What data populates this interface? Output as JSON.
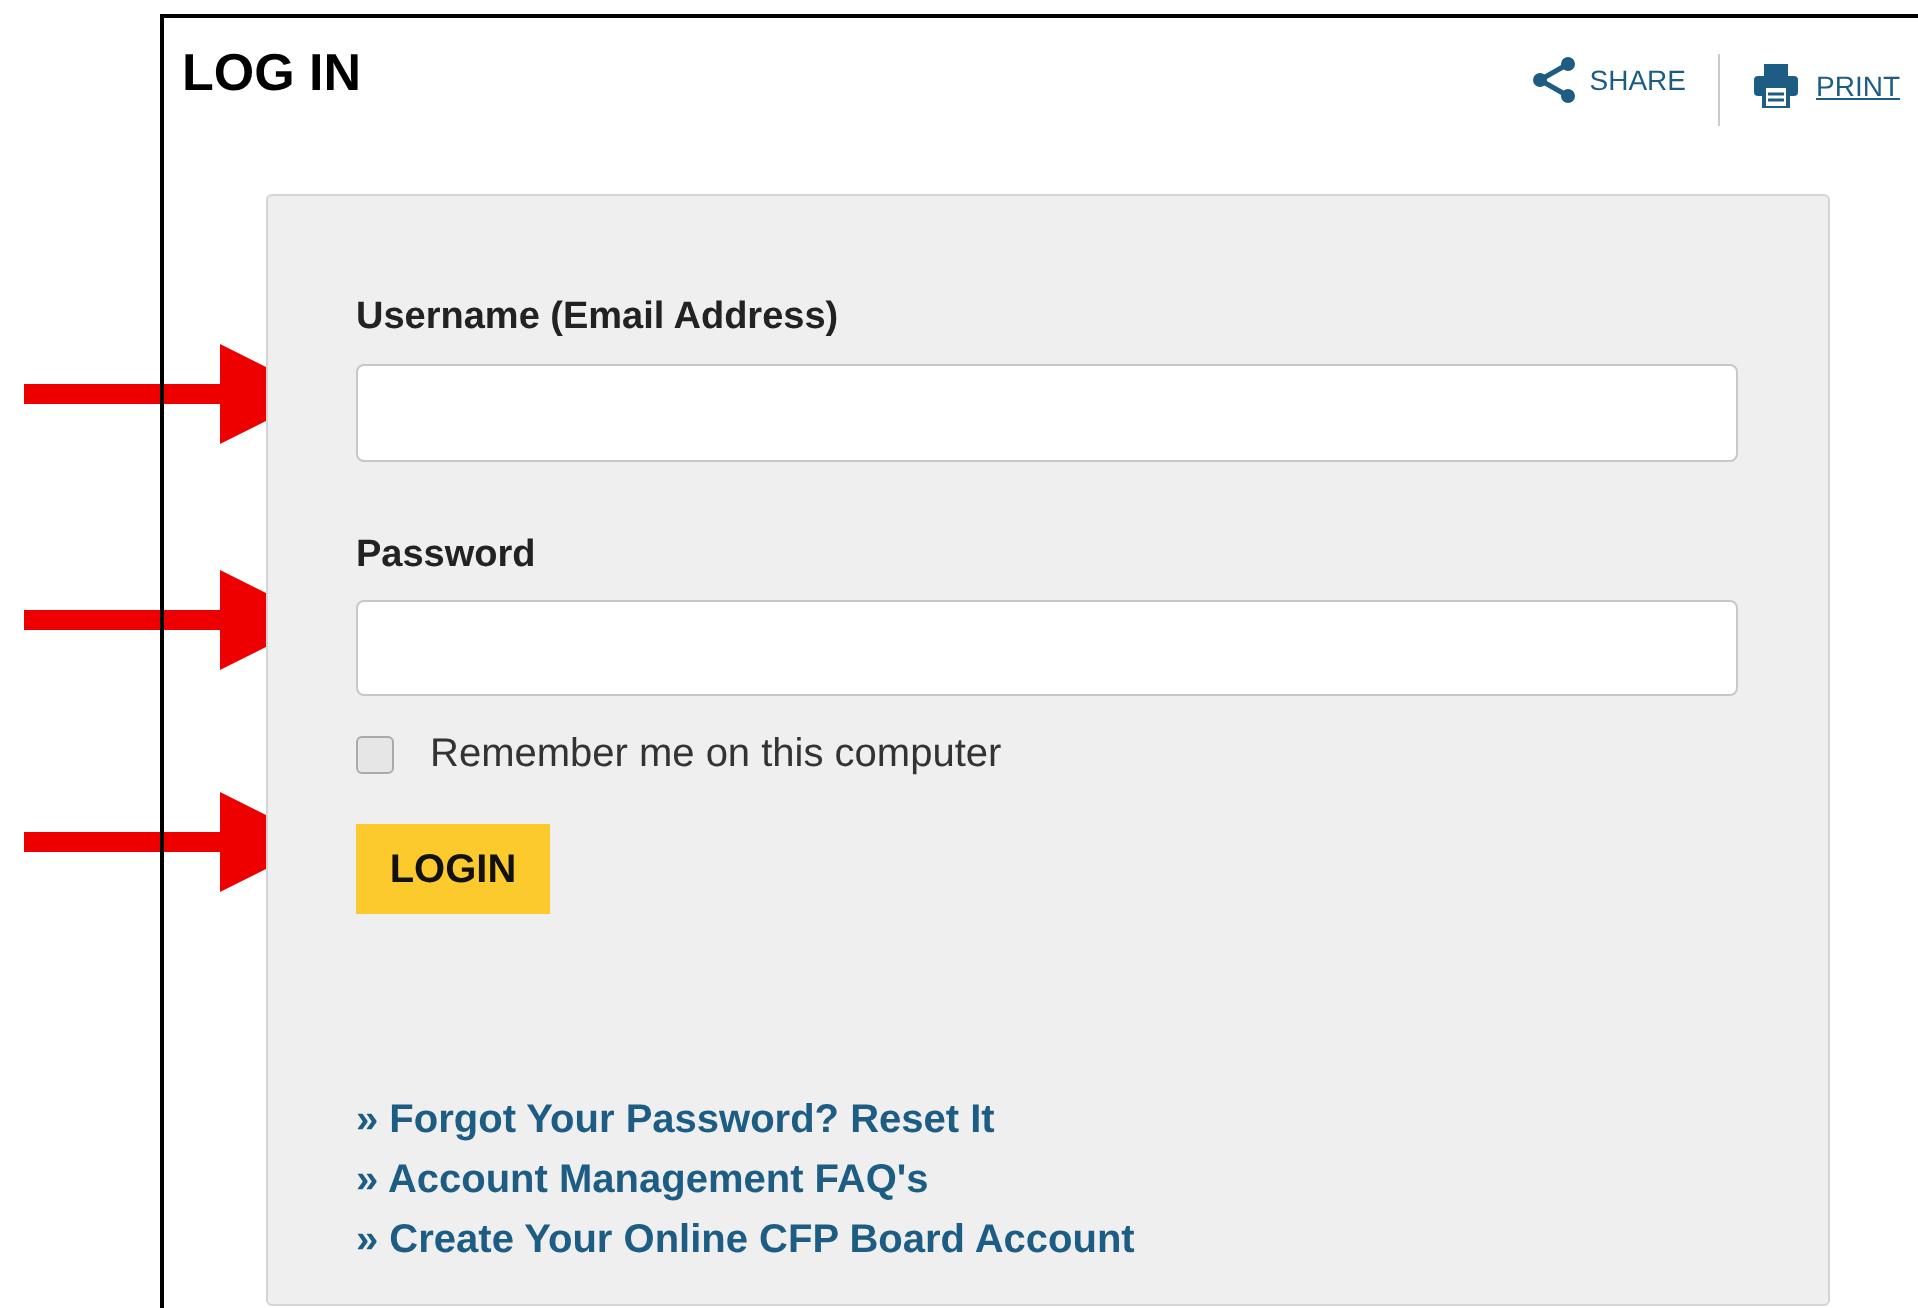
{
  "title": "LOG IN",
  "toolbar": {
    "share": "SHARE",
    "print": "PRINT"
  },
  "form": {
    "username_label": "Username (Email Address)",
    "password_label": "Password",
    "remember": {
      "label": "Remember me on this computer",
      "checked": false
    },
    "login_button": "LOGIN"
  },
  "links": [
    "» Forgot Your Password? Reset It",
    "» Account Management FAQ's",
    "» Create Your Online CFP Board Account"
  ]
}
